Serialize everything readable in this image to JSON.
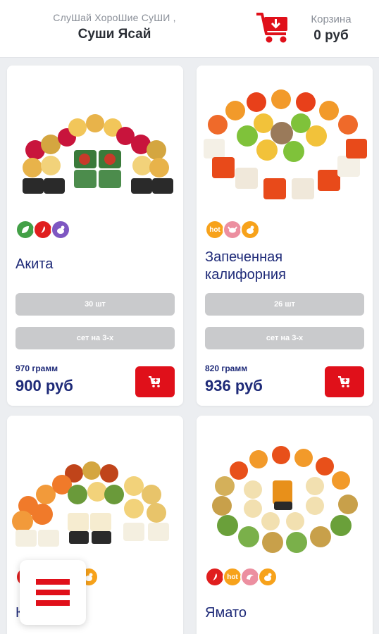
{
  "header": {
    "tagline": "СлуШай ХороШие СуШИ ,",
    "brand": "Суши Ясай",
    "cart_label": "Корзина",
    "cart_total": "0 руб"
  },
  "products": [
    {
      "title": "Акита",
      "pieces": "30 шт",
      "serving": "сет на 3-х",
      "weight": "970 грамм",
      "price": "900 руб",
      "badges": [
        "leaf-icon",
        "chili-icon",
        "chicken-icon"
      ]
    },
    {
      "title": "Запеченная калифорния",
      "pieces": "26 шт",
      "serving": "сет на 3-х",
      "weight": "820 грамм",
      "price": "936 руб",
      "badges": [
        "hot",
        "crab-icon",
        "chicken-icon"
      ]
    },
    {
      "title": "К",
      "badges": [
        "chili-icon",
        "hot",
        "chicken-icon"
      ]
    },
    {
      "title": "Ямато",
      "badges": [
        "chili-icon",
        "hot",
        "shrimp-icon",
        "chicken-icon"
      ]
    }
  ],
  "colors": {
    "accent": "#e0101a",
    "title": "#1e2a78",
    "pill": "#c9cacc"
  }
}
